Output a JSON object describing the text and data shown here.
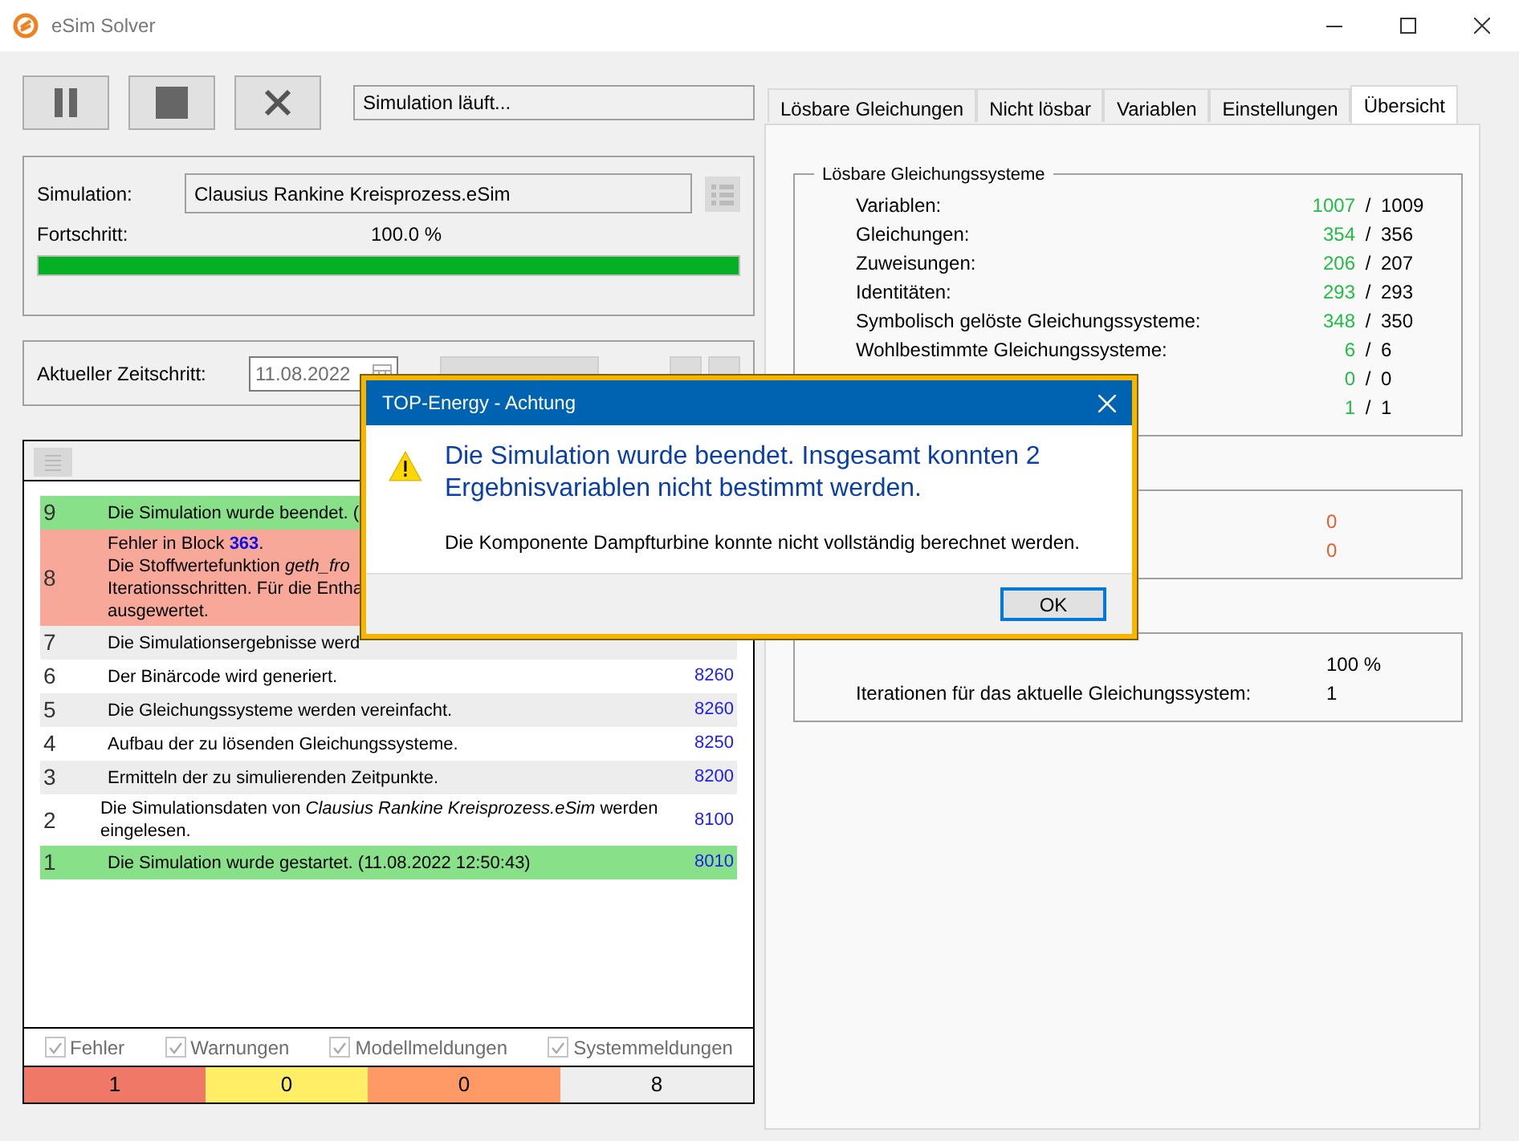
{
  "window": {
    "title": "eSim Solver"
  },
  "toolbar": {
    "status": "Simulation läuft..."
  },
  "simulation": {
    "label": "Simulation:",
    "file": "Clausius Rankine Kreisprozess.eSim",
    "progress_label": "Fortschritt:",
    "progress_text": "100.0 %",
    "level": 1.0
  },
  "timestep": {
    "label": "Aktueller Zeitschritt:",
    "date": "11.08.2022"
  },
  "log": {
    "rows": [
      {
        "num": "9",
        "kind": "finished",
        "text": "Die Simulation wurde beendet. ("
      },
      {
        "num": "8",
        "kind": "error",
        "text": "Fehler in Block **363**.\nDie Stoffwertefunktion *geth_fro*\nIterationsschritten. Für die Entha\nausgewertet."
      },
      {
        "num": "7",
        "kind": "info",
        "text": "Die Simulationsergebnisse werd"
      },
      {
        "num": "6",
        "kind": "info",
        "text": "Der Binärcode wird generiert.",
        "code": "8260"
      },
      {
        "num": "5",
        "kind": "info",
        "text": "Die Gleichungssysteme werden vereinfacht.",
        "code": "8260"
      },
      {
        "num": "4",
        "kind": "info",
        "text": "Aufbau der zu lösenden Gleichungssysteme.",
        "code": "8250"
      },
      {
        "num": "3",
        "kind": "info",
        "text": "Ermitteln der zu simulierenden Zeitpunkte.",
        "code": "8200"
      },
      {
        "num": "2",
        "kind": "info",
        "text": "Die Simulationsdaten von *Clausius Rankine Kreisprozess.eSim* werden eingelesen.",
        "code": "8100"
      },
      {
        "num": "1",
        "kind": "finished",
        "text": "Die Simulation wurde gestartet. (11.08.2022 12:50:43)",
        "code": "8010"
      }
    ],
    "filters": [
      {
        "label": "Fehler",
        "checked": true
      },
      {
        "label": "Warnungen",
        "checked": true
      },
      {
        "label": "Modellmeldungen",
        "checked": true
      },
      {
        "label": "Systemmeldungen",
        "checked": true
      }
    ],
    "counts": [
      {
        "value": "1",
        "color": "#ef7866"
      },
      {
        "value": "0",
        "color": "#ffee66"
      },
      {
        "value": "0",
        "color": "#ff9966"
      },
      {
        "value": "8",
        "color": "#eeeeee"
      }
    ]
  },
  "tabs": [
    {
      "label": "Lösbare Gleichungen",
      "selected": false
    },
    {
      "label": "Nicht lösbar",
      "selected": false
    },
    {
      "label": "Variablen",
      "selected": false
    },
    {
      "label": "Einstellungen",
      "selected": false
    },
    {
      "label": "Übersicht",
      "selected": true
    }
  ],
  "overview": {
    "title": "Lösbare Gleichungssysteme",
    "stats": [
      {
        "label": "Variablen:",
        "solved": "1007",
        "separator": "/",
        "total": "1009"
      },
      {
        "label": "Gleichungen:",
        "solved": "354",
        "separator": "/",
        "total": "356"
      },
      {
        "label": "Zuweisungen:",
        "solved": "206",
        "separator": "/",
        "total": "207"
      },
      {
        "label": "Identitäten:",
        "solved": "293",
        "separator": "/",
        "total": "293"
      },
      {
        "label": "Symbolisch gelöste Gleichungssysteme:",
        "solved": "348",
        "separator": "/",
        "total": "350"
      },
      {
        "label": "Wohlbestimmte Gleichungssysteme:",
        "solved": "6",
        "separator": "/",
        "total": "6"
      },
      {
        "solved": "0",
        "separator": "/",
        "total": "0"
      },
      {
        "solved": "1",
        "separator": "/",
        "total": "1"
      }
    ],
    "group_2_values": [
      "0",
      "0"
    ],
    "group_3_rows": [
      {
        "value": "100 %"
      },
      {
        "label": "Iterationen für das aktuelle Gleichungssystem:",
        "value": "1"
      }
    ]
  },
  "dialog": {
    "title": "TOP-Energy - Achtung",
    "message": "Die Simulation wurde beendet. Insgesamt konnten 2 Ergebnisvariablen nicht bestimmt werden.",
    "detail": "Die Komponente Dampfturbine konnte nicht vollständig berechnet werden.",
    "button": "OK"
  }
}
